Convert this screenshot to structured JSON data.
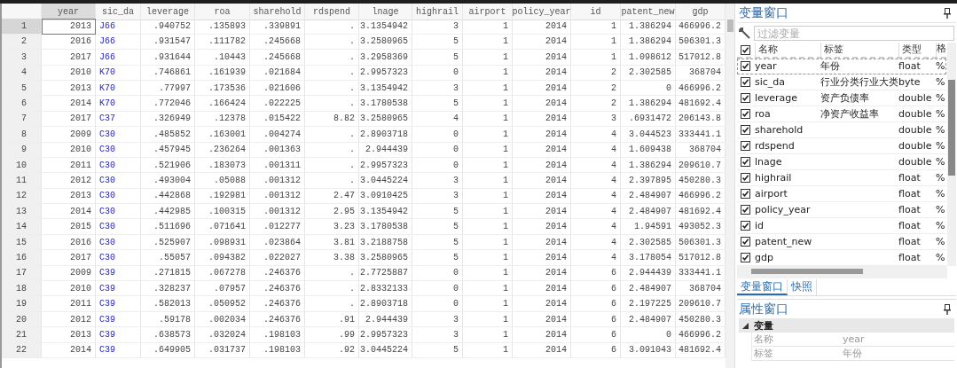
{
  "data_grid": {
    "columns": [
      {
        "name": "year",
        "kind": "numeric",
        "selected": true
      },
      {
        "name": "sic_da",
        "kind": "labeled",
        "selected": false
      },
      {
        "name": "leverage",
        "kind": "numeric",
        "selected": false
      },
      {
        "name": "roa",
        "kind": "numeric",
        "selected": false
      },
      {
        "name": "sharehold",
        "kind": "numeric",
        "selected": false
      },
      {
        "name": "rdspend",
        "kind": "numeric",
        "selected": false
      },
      {
        "name": "lnage",
        "kind": "numeric",
        "selected": false
      },
      {
        "name": "highrail",
        "kind": "numeric",
        "selected": false
      },
      {
        "name": "airport",
        "kind": "numeric",
        "selected": false
      },
      {
        "name": "policy_year",
        "kind": "numeric",
        "selected": false
      },
      {
        "name": "id",
        "kind": "numeric",
        "selected": false
      },
      {
        "name": "patent_new",
        "kind": "numeric",
        "selected": false
      },
      {
        "name": "gdp",
        "kind": "numeric",
        "selected": false
      }
    ],
    "rows": [
      {
        "number": "1",
        "selected": true,
        "cells": [
          "2013",
          "J66",
          ".940752",
          ".135893",
          ".339891",
          ".",
          "3.1354942",
          "3",
          "1",
          "2014",
          "1",
          "1.386294",
          "466996.2"
        ]
      },
      {
        "number": "2",
        "selected": false,
        "cells": [
          "2016",
          "J66",
          ".931547",
          ".111782",
          ".245668",
          ".",
          "3.2580965",
          "5",
          "1",
          "2014",
          "1",
          "1.386294",
          "506301.3"
        ]
      },
      {
        "number": "3",
        "selected": false,
        "cells": [
          "2017",
          "J66",
          ".931644",
          ".10443",
          ".245668",
          ".",
          "3.2958369",
          "5",
          "1",
          "2014",
          "1",
          "1.098612",
          "517012.8"
        ]
      },
      {
        "number": "4",
        "selected": false,
        "cells": [
          "2010",
          "K70",
          ".746861",
          ".161939",
          ".021684",
          ".",
          "2.9957323",
          "0",
          "1",
          "2014",
          "2",
          "2.302585",
          "368704"
        ]
      },
      {
        "number": "5",
        "selected": false,
        "cells": [
          "2013",
          "K70",
          ".77997",
          ".173536",
          ".021606",
          ".",
          "3.1354942",
          "3",
          "1",
          "2014",
          "2",
          "0",
          "466996.2"
        ]
      },
      {
        "number": "6",
        "selected": false,
        "cells": [
          "2014",
          "K70",
          ".772046",
          ".166424",
          ".022225",
          ".",
          "3.1780538",
          "5",
          "1",
          "2014",
          "2",
          "1.386294",
          "481692.4"
        ]
      },
      {
        "number": "7",
        "selected": false,
        "cells": [
          "2017",
          "C37",
          ".326949",
          ".12378",
          ".015422",
          "8.82",
          "3.2580965",
          "4",
          "1",
          "2014",
          "3",
          ".6931472",
          "206143.8"
        ]
      },
      {
        "number": "8",
        "selected": false,
        "cells": [
          "2009",
          "C30",
          ".485852",
          ".163001",
          ".004274",
          ".",
          "2.8903718",
          "0",
          "1",
          "2014",
          "4",
          "3.044523",
          "333441.1"
        ]
      },
      {
        "number": "9",
        "selected": false,
        "cells": [
          "2010",
          "C30",
          ".457945",
          ".236264",
          ".001363",
          ".",
          "2.944439",
          "0",
          "1",
          "2014",
          "4",
          "1.609438",
          "368704"
        ]
      },
      {
        "number": "10",
        "selected": false,
        "cells": [
          "2011",
          "C30",
          ".521906",
          ".183073",
          ".001311",
          ".",
          "2.9957323",
          "0",
          "1",
          "2014",
          "4",
          "1.386294",
          "209610.7"
        ]
      },
      {
        "number": "11",
        "selected": false,
        "cells": [
          "2012",
          "C30",
          ".493004",
          ".05088",
          ".001312",
          ".",
          "3.0445224",
          "3",
          "1",
          "2014",
          "4",
          "2.397895",
          "450280.3"
        ]
      },
      {
        "number": "12",
        "selected": false,
        "cells": [
          "2013",
          "C30",
          ".442868",
          ".192981",
          ".001312",
          "2.47",
          "3.0910425",
          "3",
          "1",
          "2014",
          "4",
          "2.484907",
          "466996.2"
        ]
      },
      {
        "number": "13",
        "selected": false,
        "cells": [
          "2014",
          "C30",
          ".442985",
          ".100315",
          ".001312",
          "2.95",
          "3.1354942",
          "5",
          "1",
          "2014",
          "4",
          "2.484907",
          "481692.4"
        ]
      },
      {
        "number": "14",
        "selected": false,
        "cells": [
          "2015",
          "C30",
          ".511696",
          ".071641",
          ".012277",
          "3.23",
          "3.1780538",
          "5",
          "1",
          "2014",
          "4",
          "1.94591",
          "493052.3"
        ]
      },
      {
        "number": "15",
        "selected": false,
        "cells": [
          "2016",
          "C30",
          ".525907",
          ".098931",
          ".023864",
          "3.81",
          "3.2188758",
          "5",
          "1",
          "2014",
          "4",
          "2.302585",
          "506301.3"
        ]
      },
      {
        "number": "16",
        "selected": false,
        "cells": [
          "2017",
          "C30",
          ".55057",
          ".094382",
          ".022027",
          "3.38",
          "3.2580965",
          "5",
          "1",
          "2014",
          "4",
          "3.178054",
          "517012.8"
        ]
      },
      {
        "number": "17",
        "selected": false,
        "cells": [
          "2009",
          "C39",
          ".271815",
          ".067278",
          ".246376",
          ".",
          "2.7725887",
          "0",
          "1",
          "2014",
          "6",
          "2.944439",
          "333441.1"
        ]
      },
      {
        "number": "18",
        "selected": false,
        "cells": [
          "2010",
          "C39",
          ".328237",
          ".07957",
          ".246376",
          ".",
          "2.8332133",
          "0",
          "1",
          "2014",
          "6",
          "2.484907",
          "368704"
        ]
      },
      {
        "number": "19",
        "selected": false,
        "cells": [
          "2011",
          "C39",
          ".582013",
          ".050952",
          ".246376",
          ".",
          "2.8903718",
          "0",
          "1",
          "2014",
          "6",
          "2.197225",
          "209610.7"
        ]
      },
      {
        "number": "20",
        "selected": false,
        "cells": [
          "2012",
          "C39",
          ".59178",
          ".002034",
          ".246376",
          ".91",
          "2.944439",
          "3",
          "1",
          "2014",
          "6",
          "2.484907",
          "450280.3"
        ]
      },
      {
        "number": "21",
        "selected": false,
        "cells": [
          "2013",
          "C39",
          ".638573",
          ".032024",
          ".198103",
          ".99",
          "2.9957323",
          "3",
          "1",
          "2014",
          "6",
          "0",
          "466996.2"
        ]
      },
      {
        "number": "22",
        "selected": false,
        "cells": [
          "2014",
          "C39",
          ".649905",
          ".031737",
          ".198103",
          ".92",
          "3.0445224",
          "5",
          "1",
          "2014",
          "6",
          "3.091043",
          "481692.4"
        ]
      }
    ]
  },
  "variables_window": {
    "title": "变量窗口",
    "filter_placeholder": "过滤变量",
    "header_checked": true,
    "columns": [
      "名称",
      "标签",
      "类型",
      "格"
    ],
    "variables": [
      {
        "checked": true,
        "selected": true,
        "name": "year",
        "label": "年份",
        "type": "float",
        "format": "%"
      },
      {
        "checked": true,
        "selected": false,
        "name": "sic_da",
        "label": "行业分类行业大类",
        "type": "byte",
        "format": "%"
      },
      {
        "checked": true,
        "selected": false,
        "name": "leverage",
        "label": "资产负债率",
        "type": "double",
        "format": "%"
      },
      {
        "checked": true,
        "selected": false,
        "name": "roa",
        "label": "净资产收益率",
        "type": "double",
        "format": "%"
      },
      {
        "checked": true,
        "selected": false,
        "name": "sharehold",
        "type": "double",
        "format": "%"
      },
      {
        "checked": true,
        "selected": false,
        "name": "rdspend",
        "type": "double",
        "format": "%"
      },
      {
        "checked": true,
        "selected": false,
        "name": "lnage",
        "type": "double",
        "format": "%"
      },
      {
        "checked": true,
        "selected": false,
        "name": "highrail",
        "type": "float",
        "format": "%"
      },
      {
        "checked": true,
        "selected": false,
        "name": "airport",
        "type": "float",
        "format": "%"
      },
      {
        "checked": true,
        "selected": false,
        "name": "policy_year",
        "type": "float",
        "format": "%"
      },
      {
        "checked": true,
        "selected": false,
        "name": "id",
        "type": "float",
        "format": "%"
      },
      {
        "checked": true,
        "selected": false,
        "name": "patent_new",
        "type": "float",
        "format": "%"
      },
      {
        "checked": true,
        "selected": false,
        "name": "gdp",
        "type": "float",
        "format": "%"
      }
    ],
    "tabs": [
      {
        "label": "变量窗口",
        "selected": true
      },
      {
        "label": "快照",
        "selected": false
      }
    ]
  },
  "properties_window": {
    "title": "属性窗口",
    "section": "变量",
    "expanded": true,
    "rows": [
      {
        "key": "名称",
        "value": "year"
      },
      {
        "key": "标签",
        "value": "年份"
      }
    ]
  }
}
